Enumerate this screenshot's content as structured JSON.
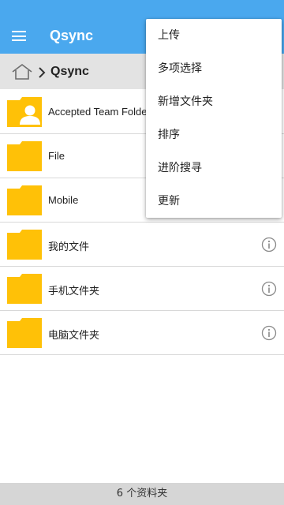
{
  "app_bar": {
    "title": "Qsync",
    "background": "#4aa8ee",
    "menu_icon": "hamburger-menu-icon"
  },
  "breadcrumb": {
    "home_icon": "home-icon",
    "separator_icon": "chevron-right-icon",
    "current": "Qsync"
  },
  "folders": [
    {
      "name": "Accepted Team Folder",
      "icon": "shared-folder-icon"
    },
    {
      "name": "File",
      "icon": "folder-icon"
    },
    {
      "name": "Mobile",
      "icon": "folder-icon"
    },
    {
      "name": "我的文件",
      "icon": "folder-icon",
      "info_icon": "info-icon"
    },
    {
      "name": "手机文件夹",
      "icon": "folder-icon",
      "info_icon": "info-icon"
    },
    {
      "name": "电脑文件夹",
      "icon": "folder-icon",
      "info_icon": "info-icon"
    }
  ],
  "folder_color": "#ffc107",
  "menu": {
    "items": [
      {
        "label": "上传"
      },
      {
        "label": "多项选择"
      },
      {
        "label": "新增文件夹"
      },
      {
        "label": "排序"
      },
      {
        "label": "进阶搜寻"
      },
      {
        "label": "更新"
      }
    ]
  },
  "footer": {
    "text": "6 个资料夹"
  }
}
